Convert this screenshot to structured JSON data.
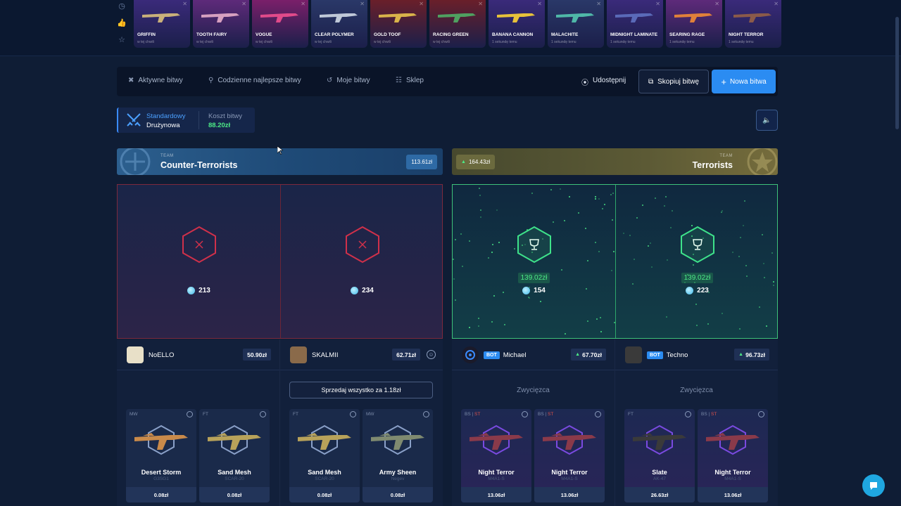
{
  "top_drops": [
    {
      "name": "GRIFFIN",
      "sub": "w tej chwili",
      "bg": "#3a2a7a",
      "gun": "#c9b07a"
    },
    {
      "name": "TOOTH FAIRY",
      "sub": "w tej chwili",
      "bg": "#5e2a7a",
      "gun": "#d6a0c0"
    },
    {
      "name": "VOGUE",
      "sub": "w tej chwili",
      "bg": "#7a1f6a",
      "gun": "#e04a8a"
    },
    {
      "name": "CLEAR POLYMER",
      "sub": "w tej chwili",
      "bg": "#2a3868",
      "gun": "#bfc8d8"
    },
    {
      "name": "GOLD TOOF",
      "sub": "w tej chwili",
      "bg": "#6a1f2a",
      "gun": "#d9b34a"
    },
    {
      "name": "RACING GREEN",
      "sub": "w tej chwili",
      "bg": "#6a1f2a",
      "gun": "#4fa060"
    },
    {
      "name": "BANANA CANNON",
      "sub": "1 sekundę temu",
      "bg": "#3a2a7a",
      "gun": "#e7c23a"
    },
    {
      "name": "MALACHITE",
      "sub": "1 sekundę temu",
      "bg": "#2a3868",
      "gun": "#4fb8a8"
    },
    {
      "name": "MIDNIGHT LAMINATE",
      "sub": "1 sekundę temu",
      "bg": "#3a2a7a",
      "gun": "#5a6ab8"
    },
    {
      "name": "SEARING RAGE",
      "sub": "1 sekundę temu",
      "bg": "#5e2a7a",
      "gun": "#e0803a"
    },
    {
      "name": "NIGHT TERROR",
      "sub": "1 sekundę temu",
      "bg": "#3a2a7a",
      "gun": "#8a5a4a"
    }
  ],
  "nav": {
    "active_battles": "Aktywne bitwy",
    "daily_best": "Codzienne najlepsze bitwy",
    "my_battles": "Moje bitwy",
    "shop": "Sklep",
    "share": "Udostępnij",
    "copy": "Skopiuj bitwę",
    "new_battle": "Nowa bitwa"
  },
  "mode": {
    "type": "Standardowy",
    "team": "Drużynowa",
    "cost_label": "Koszt bitwy",
    "cost_value": "88.20zł"
  },
  "teams": {
    "ct": {
      "label": "TEAM",
      "name": "Counter-Terrorists",
      "value": "113.61zł"
    },
    "t": {
      "label": "TEAM",
      "name": "Terrorists",
      "value": "164.43zł"
    }
  },
  "rolls": {
    "ct": [
      {
        "value": "213"
      },
      {
        "value": "234"
      }
    ],
    "t": [
      {
        "value": "154",
        "win": "139.02zł"
      },
      {
        "value": "223",
        "win": "139.02zł"
      }
    ]
  },
  "players": [
    {
      "name": "NoELLO",
      "value": "50.90zł",
      "bot": false,
      "items": [
        {
          "wear": "MW",
          "st": false,
          "name": "Desert Storm",
          "sub": "G3SG1",
          "price": "0.08zł",
          "gun": "#c98a4a"
        },
        {
          "wear": "FT",
          "st": false,
          "name": "Sand Mesh",
          "sub": "SCAR-20",
          "price": "0.08zł",
          "gun": "#b8a25a"
        }
      ]
    },
    {
      "name": "SKALMII",
      "value": "62.71zł",
      "bot": false,
      "sell": "Sprzedaj wszystko za 1.18zł",
      "items": [
        {
          "wear": "FT",
          "st": false,
          "name": "Sand Mesh",
          "sub": "SCAR-20",
          "price": "0.08zł",
          "gun": "#b8a25a"
        },
        {
          "wear": "MW",
          "st": false,
          "name": "Army Sheen",
          "sub": "Negev",
          "price": "0.08zł",
          "gun": "#7f8a70"
        }
      ]
    },
    {
      "name": "Michael",
      "value": "67.70zł",
      "bot": true,
      "bot_label": "BOT",
      "winner": "Zwycięzca",
      "items": [
        {
          "wear": "BS",
          "st": true,
          "st_label": "ST",
          "name": "Night Terror",
          "sub": "M4A1-S",
          "price": "13.06zł",
          "gun": "#8a3a4a"
        },
        {
          "wear": "BS",
          "st": true,
          "st_label": "ST",
          "name": "Night Terror",
          "sub": "M4A1-S",
          "price": "13.06zł",
          "gun": "#8a3a4a"
        }
      ]
    },
    {
      "name": "Techno",
      "value": "96.73zł",
      "bot": true,
      "bot_label": "BOT",
      "winner": "Zwycięzca",
      "items": [
        {
          "wear": "FT",
          "st": false,
          "name": "Slate",
          "sub": "AK-47",
          "price": "26.63zł",
          "gun": "#3a3a3a"
        },
        {
          "wear": "BS",
          "st": true,
          "st_label": "ST",
          "name": "Night Terror",
          "sub": "M4A1-S",
          "price": "13.06zł",
          "gun": "#8a3a4a"
        }
      ]
    }
  ]
}
